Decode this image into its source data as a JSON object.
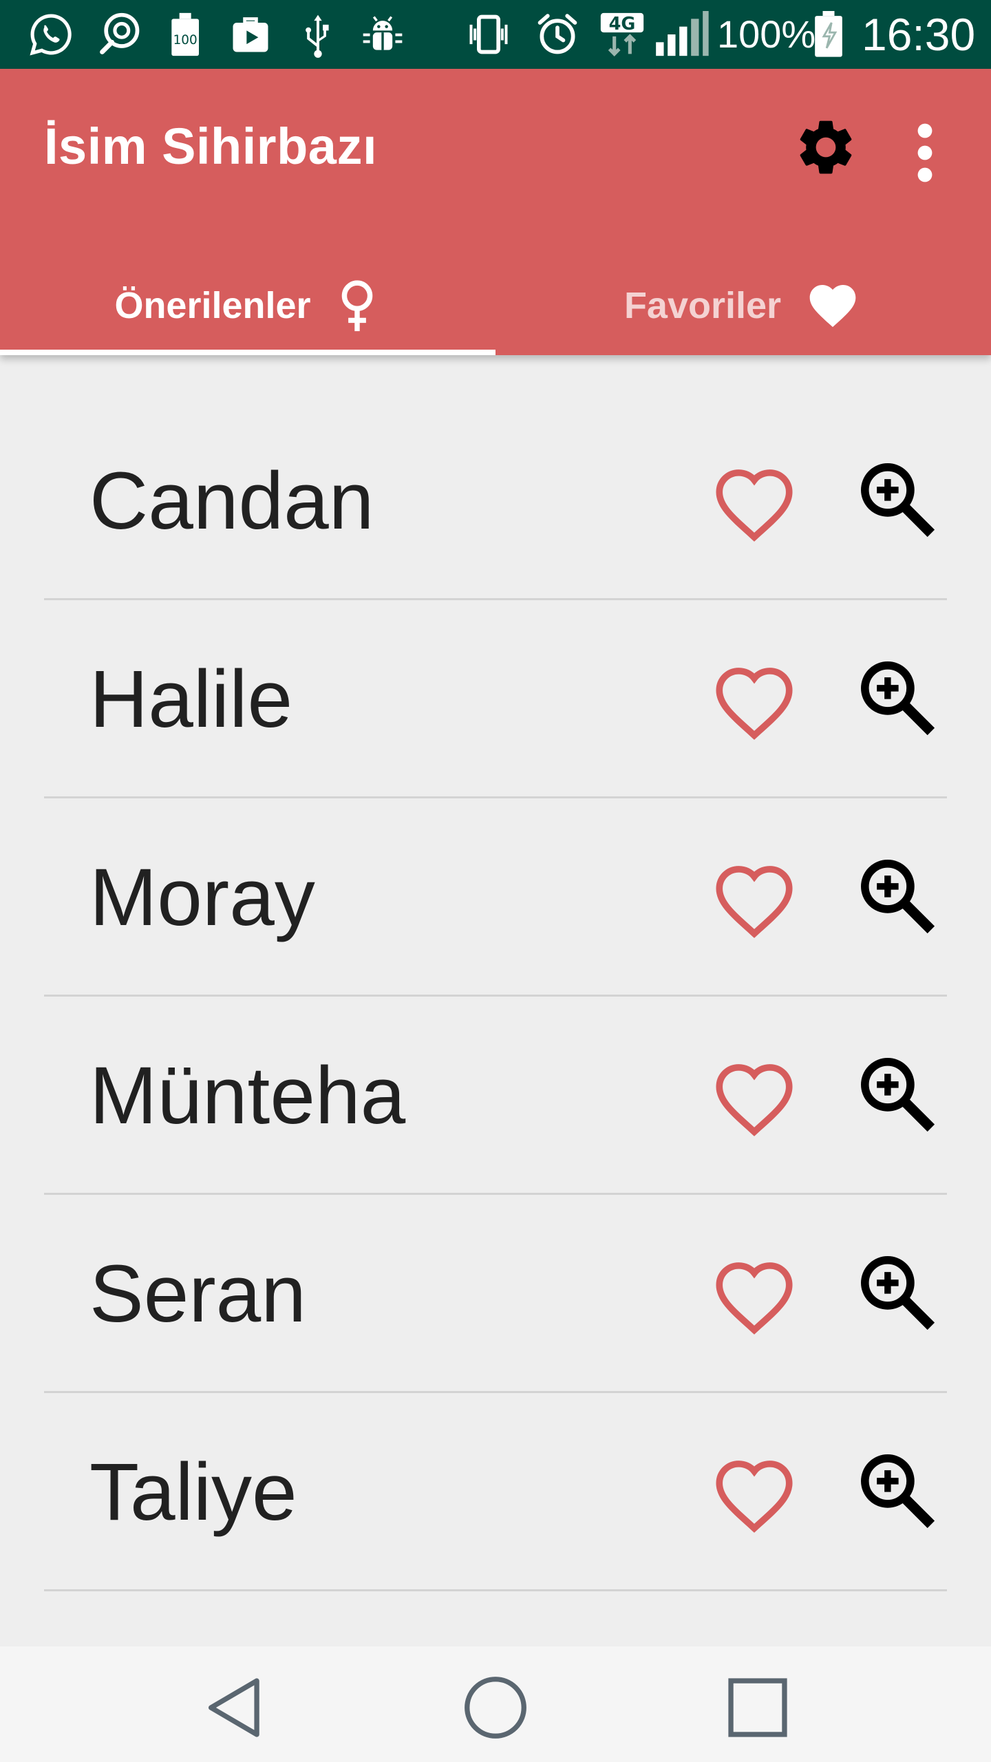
{
  "status_bar": {
    "battery_percent": "100%",
    "time": "16:30",
    "network": "4G",
    "notification_icons": [
      "whatsapp-icon",
      "chat-search-icon",
      "battery-100-icon",
      "briefcase-icon",
      "usb-icon",
      "android-debug-icon"
    ],
    "system_icons": [
      "vibrate-icon",
      "alarm-icon",
      "4g-data-icon",
      "signal-icon",
      "battery-charging-icon"
    ]
  },
  "app_bar": {
    "title": "İsim Sihirbazı",
    "settings_icon": "gear-icon",
    "overflow_icon": "more-vert-icon",
    "background_color": "#d65d5d"
  },
  "tabs": [
    {
      "label": "Önerilenler",
      "icon": "female-symbol-icon",
      "selected": true
    },
    {
      "label": "Favoriler",
      "icon": "heart-filled-icon",
      "selected": false
    }
  ],
  "names": [
    {
      "name": "Candan"
    },
    {
      "name": "Halile"
    },
    {
      "name": "Moray"
    },
    {
      "name": "Münteha"
    },
    {
      "name": "Seran"
    },
    {
      "name": "Taliye"
    }
  ],
  "row_actions": {
    "favorite_icon": "heart-outline-icon",
    "details_icon": "zoom-in-icon",
    "favorite_color": "#d65d5d"
  },
  "nav_bar": {
    "buttons": [
      "back-icon",
      "home-icon",
      "recents-icon"
    ]
  }
}
